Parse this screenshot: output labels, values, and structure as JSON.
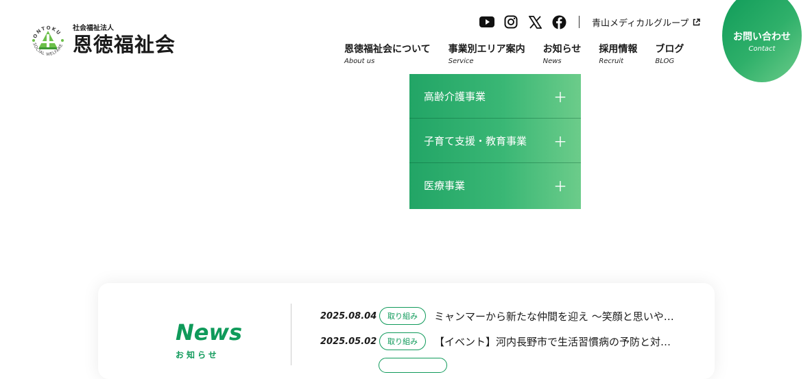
{
  "logo": {
    "arc_text": "ONTOKU SOCIAL WELFARE",
    "small": "社会福祉法人",
    "name": "恩徳福祉会"
  },
  "socials": {
    "icons": [
      "youtube-icon",
      "instagram-icon",
      "x-icon",
      "facebook-icon"
    ],
    "group_link": "青山メディカルグループ"
  },
  "nav": [
    {
      "jp": "恩徳福祉会について",
      "en": "About us"
    },
    {
      "jp": "事業別エリア案内",
      "en": "Service"
    },
    {
      "jp": "お知らせ",
      "en": "News"
    },
    {
      "jp": "採用情報",
      "en": "Recruit"
    },
    {
      "jp": "ブログ",
      "en": "BLOG"
    }
  ],
  "contact": {
    "jp": "お問い合わせ",
    "en": "Contact"
  },
  "dropdown": [
    {
      "label": "高齢介護事業"
    },
    {
      "label": "子育て支援・教育事業"
    },
    {
      "label": "医療事業"
    }
  ],
  "news": {
    "title": "News",
    "subtitle": "お知らせ",
    "items": [
      {
        "date": "2025.08.04",
        "tag": "取り組み",
        "text": "ミャンマーから新たな仲間を迎え 〜笑顔と思いや…"
      },
      {
        "date": "2025.05.02",
        "tag": "取り組み",
        "text": "【イベント】河内長野市で生活習慣病の予防と対…"
      }
    ]
  },
  "colors": {
    "brand_green": "#0f9a5a",
    "light_green": "#6ccc8a"
  }
}
